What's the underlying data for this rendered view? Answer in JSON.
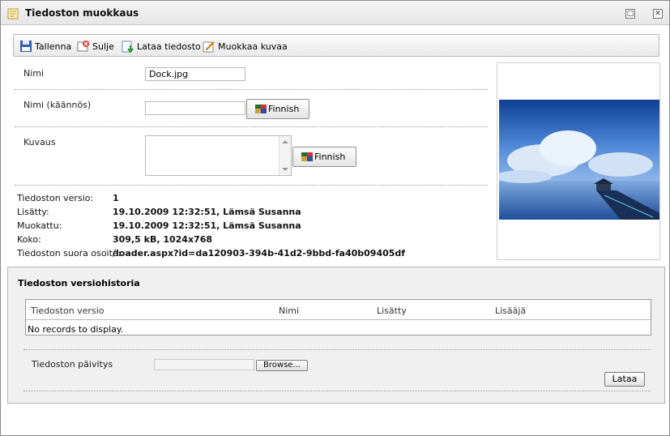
{
  "window": {
    "title": "Tiedoston muokkaus",
    "minimize_glyph": "□",
    "close_glyph": "✕"
  },
  "toolbar": {
    "save": "Tallenna",
    "close": "Sulje",
    "upload": "Lataa tiedosto",
    "edit_image": "Muokkaa kuvaa"
  },
  "form": {
    "name_label": "Nimi",
    "name_value": "Dock.jpg",
    "name_translation_label": "Nimi (käännös)",
    "name_translation_value": "",
    "description_label": "Kuvaus",
    "description_value": "",
    "language_button": "Finnish"
  },
  "info": [
    {
      "label": "Tiedoston versio:",
      "value": "1"
    },
    {
      "label": "Lisätty:",
      "value": "19.10.2009 12:32:51, Lämsä Susanna"
    },
    {
      "label": "Muokattu:",
      "value": "19.10.2009 12:32:51, Lämsä Susanna"
    },
    {
      "label": "Koko:",
      "value": "309,5 kB, 1024x768"
    },
    {
      "label": "Tiedoston suora osoite:",
      "value": "/loader.aspx?id=da120903-394b-41d2-9bbd-fa40b09405df"
    }
  ],
  "history": {
    "title": "Tiedoston versiohistoria",
    "columns": [
      "Tiedoston versio",
      "Nimi",
      "Lisätty",
      "Lisääjä"
    ],
    "empty_text": "No records to display.",
    "update_label": "Tiedoston päivitys",
    "browse_button": "Browse...",
    "upload_button": "Lataa"
  },
  "icons": {
    "title": "document-icon",
    "save": "floppy-icon",
    "close": "close-doc-icon",
    "upload": "upload-icon",
    "edit_image": "edit-image-icon",
    "language": "flag-icon"
  }
}
